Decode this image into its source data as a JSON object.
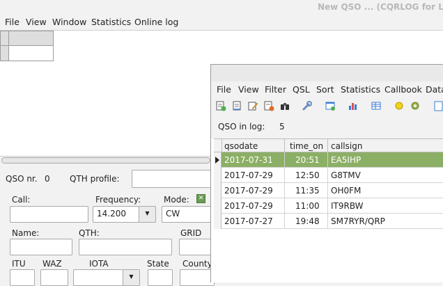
{
  "window": {
    "title": "New QSO ... (CQRLOG for Linux"
  },
  "main_menu": [
    "File",
    "View",
    "Window",
    "Statistics",
    "Online log"
  ],
  "qso_form": {
    "qso_nr_label": "QSO nr.",
    "qso_nr_value": "0",
    "qth_profile_label": "QTH profile:",
    "call_label": "Call:",
    "frequency_label": "Frequency:",
    "frequency_value": "14.200",
    "mode_label": "Mode:",
    "mode_value": "CW",
    "name_label": "Name:",
    "qth_label": "QTH:",
    "grid_label": "GRID",
    "itu_label": "ITU",
    "waz_label": "WAZ",
    "iota_label": "IOTA",
    "state_label": "State",
    "county_label": "County"
  },
  "qso_list": {
    "menu": [
      "File",
      "View",
      "Filter",
      "QSL",
      "Sort",
      "Statistics",
      "Callbook",
      "Data"
    ],
    "toolbar_icons": [
      "add-qso-icon",
      "edit-qso-icon",
      "edit-pencil-icon",
      "delete-qso-icon",
      "binoculars-icon",
      "wrench-icon",
      "export-icon",
      "statistics-icon",
      "grid-view-icon",
      "circle-icon",
      "settings-gear-icon",
      "document-icon"
    ],
    "qso_in_log_label": "QSO in log:",
    "qso_in_log_value": "5",
    "columns": [
      "qsodate",
      "time_on",
      "callsign"
    ],
    "rows": [
      {
        "qsodate": "2017-07-31",
        "time_on": "20:51",
        "callsign": "EA5IHP",
        "selected": true
      },
      {
        "qsodate": "2017-07-29",
        "time_on": "12:50",
        "callsign": "G8TMV",
        "selected": false
      },
      {
        "qsodate": "2017-07-29",
        "time_on": "11:35",
        "callsign": "OH0FM",
        "selected": false
      },
      {
        "qsodate": "2017-07-29",
        "time_on": "11:00",
        "callsign": "IT9RBW",
        "selected": false
      },
      {
        "qsodate": "2017-07-27",
        "time_on": "19:48",
        "callsign": "SM7RYR/QRP",
        "selected": false
      }
    ]
  },
  "colors": {
    "selected_row": "#8caf66",
    "mode_toggle": "#6b9b57"
  }
}
